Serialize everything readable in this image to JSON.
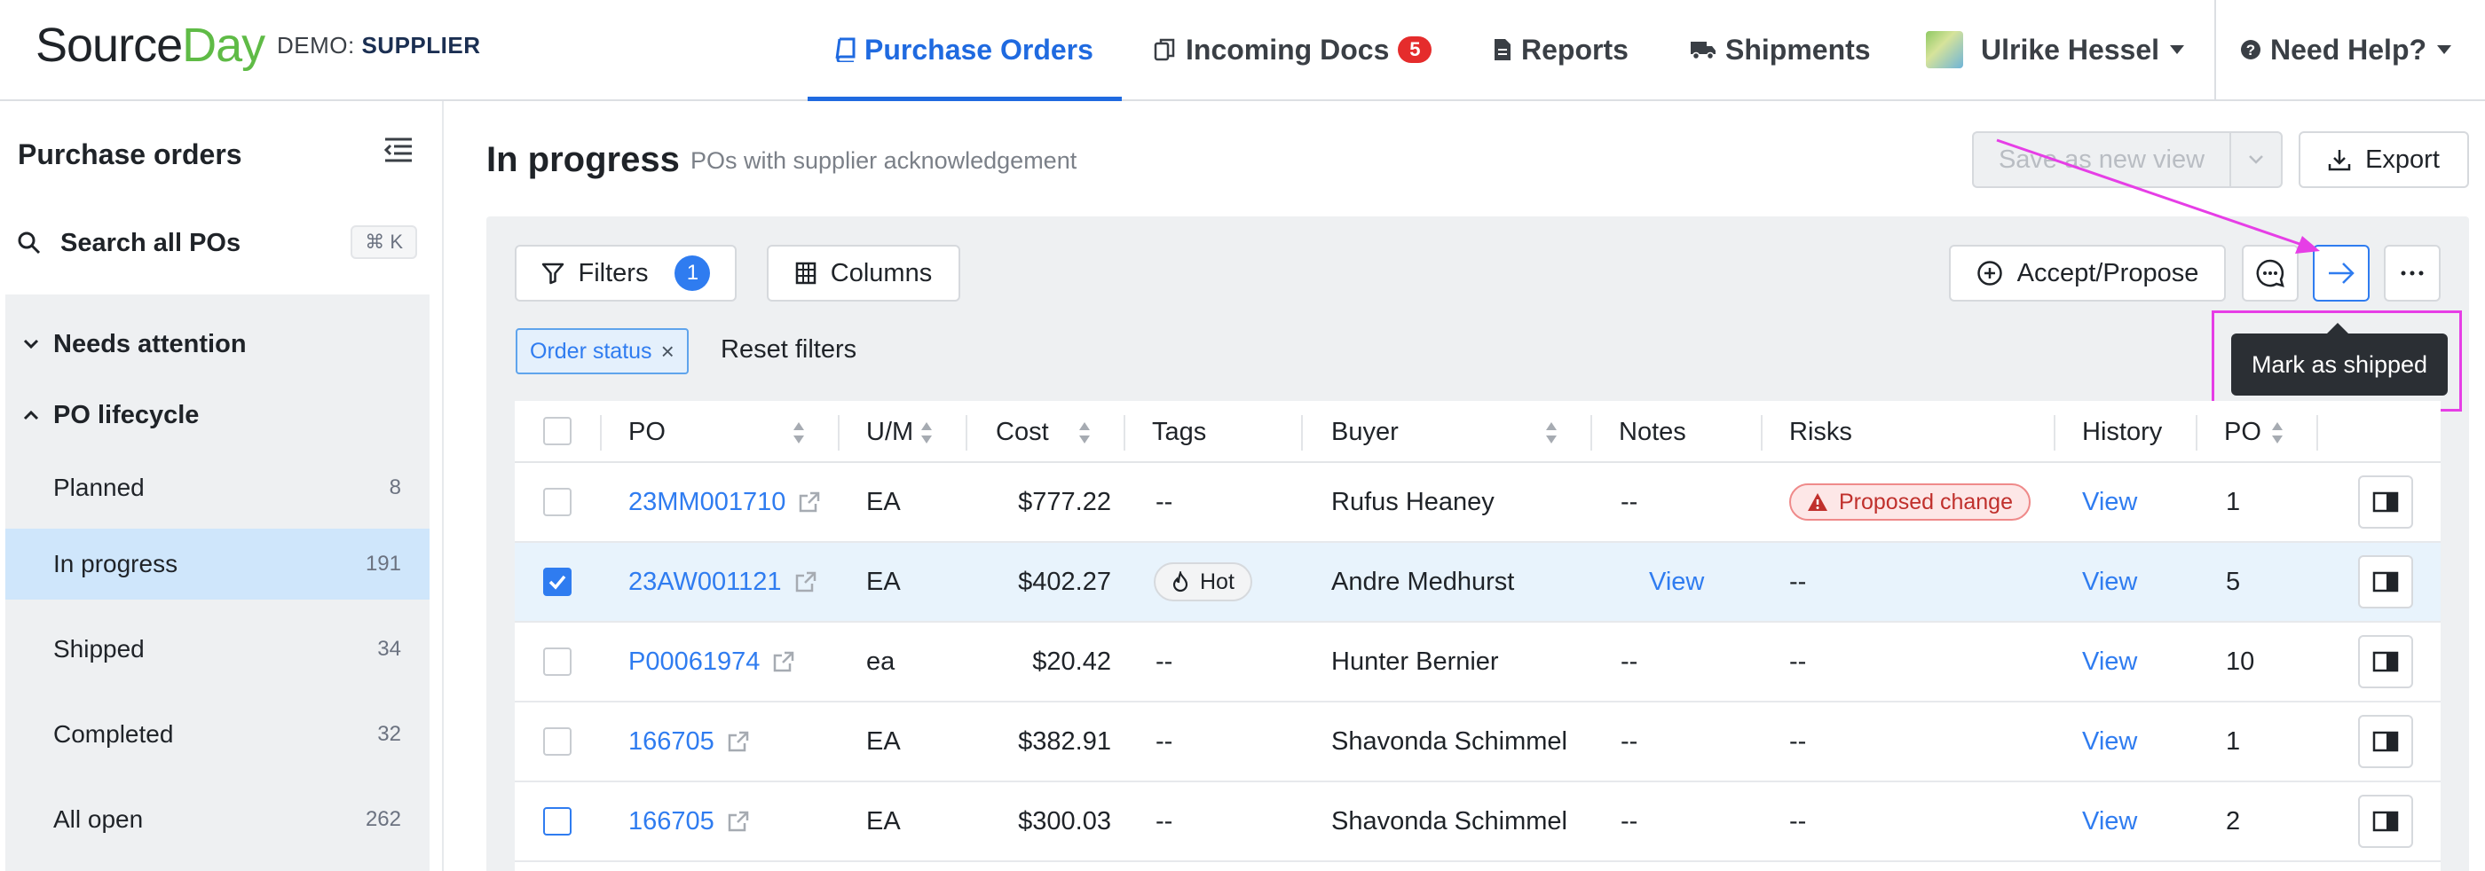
{
  "brand": {
    "logo_source": "Source",
    "logo_day": "Day",
    "demo_prefix": "DEMO:",
    "demo_role": "SUPPLIER"
  },
  "nav": {
    "purchase_orders": "Purchase Orders",
    "incoming_docs": "Incoming Docs",
    "incoming_docs_count": "5",
    "reports": "Reports",
    "shipments": "Shipments",
    "user_name": "Ulrike Hessel",
    "help": "Need Help?"
  },
  "sidebar": {
    "title": "Purchase orders",
    "search_label": "Search all POs",
    "search_shortcut": "⌘ K",
    "needs_attention": "Needs attention",
    "po_lifecycle": "PO lifecycle",
    "items": [
      {
        "label": "Planned",
        "count": "8"
      },
      {
        "label": "In progress",
        "count": "191"
      },
      {
        "label": "Shipped",
        "count": "34"
      },
      {
        "label": "Completed",
        "count": "32"
      },
      {
        "label": "All open",
        "count": "262"
      }
    ]
  },
  "main": {
    "title": "In progress",
    "subtitle": "POs with supplier acknowledgement",
    "save_view": "Save as new view",
    "export": "Export",
    "filters": "Filters",
    "filters_count": "1",
    "columns": "Columns",
    "accept_propose": "Accept/Propose",
    "chip_order_status": "Order status",
    "reset_filters": "Reset filters",
    "tooltip": "Mark as shipped"
  },
  "table": {
    "headers": {
      "po": "PO",
      "um": "U/M",
      "cost": "Cost",
      "tags": "Tags",
      "buyer": "Buyer",
      "notes": "Notes",
      "risks": "Risks",
      "history": "History",
      "po_line": "PO"
    },
    "rows": [
      {
        "po": "23MM001710",
        "um": "EA",
        "cost": "$777.22",
        "tags": "--",
        "buyer": "Rufus Heaney",
        "notes": "--",
        "risks": "Proposed change",
        "history": "View",
        "po_line": "1"
      },
      {
        "po": "23AW001121",
        "um": "EA",
        "cost": "$402.27",
        "tags": "Hot",
        "buyer": "Andre Medhurst",
        "notes": "View",
        "risks": "--",
        "history": "View",
        "po_line": "5"
      },
      {
        "po": "P00061974",
        "um": "ea",
        "cost": "$20.42",
        "tags": "--",
        "buyer": "Hunter Bernier",
        "notes": "--",
        "risks": "--",
        "history": "View",
        "po_line": "10"
      },
      {
        "po": "166705",
        "um": "EA",
        "cost": "$382.91",
        "tags": "--",
        "buyer": "Shavonda Schimmel",
        "notes": "--",
        "risks": "--",
        "history": "View",
        "po_line": "1"
      },
      {
        "po": "166705",
        "um": "EA",
        "cost": "$300.03",
        "tags": "--",
        "buyer": "Shavonda Schimmel",
        "notes": "--",
        "risks": "--",
        "history": "View",
        "po_line": "2"
      }
    ]
  },
  "colors": {
    "accent": "#2f7cf0",
    "brand_green": "#5fbb46",
    "active_bg": "#cfe6fb",
    "annotation": "#e63ee6",
    "risk_red": "#c0302c"
  }
}
